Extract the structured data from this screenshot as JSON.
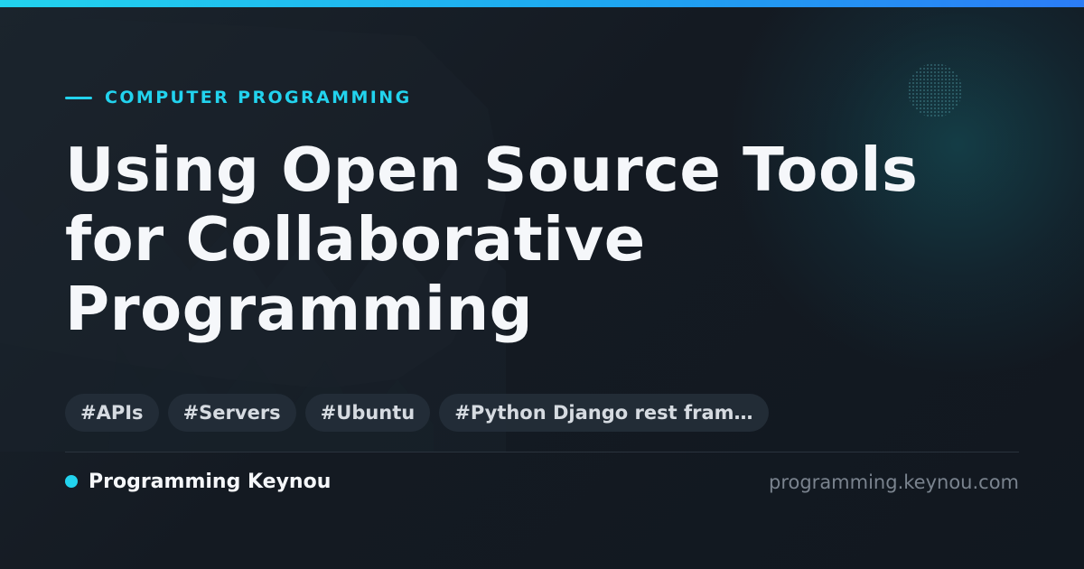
{
  "colors": {
    "accent": "#22d3ee",
    "accent_end": "#2b7cf6",
    "background": "#141a22",
    "title": "#f5f7fa",
    "tag_background": "#242e38",
    "tag_text": "#d6dbe1",
    "muted": "#7a838e"
  },
  "category": {
    "label": "COMPUTER PROGRAMMING"
  },
  "title": "Using Open Source Tools for Collaborative Programming",
  "tags": [
    {
      "label": "#APIs"
    },
    {
      "label": "#Servers"
    },
    {
      "label": "#Ubuntu"
    },
    {
      "label": "#Python Django rest fram…"
    }
  ],
  "footer": {
    "brand_name": "Programming Keynou",
    "site_url": "programming.keynou.com"
  }
}
